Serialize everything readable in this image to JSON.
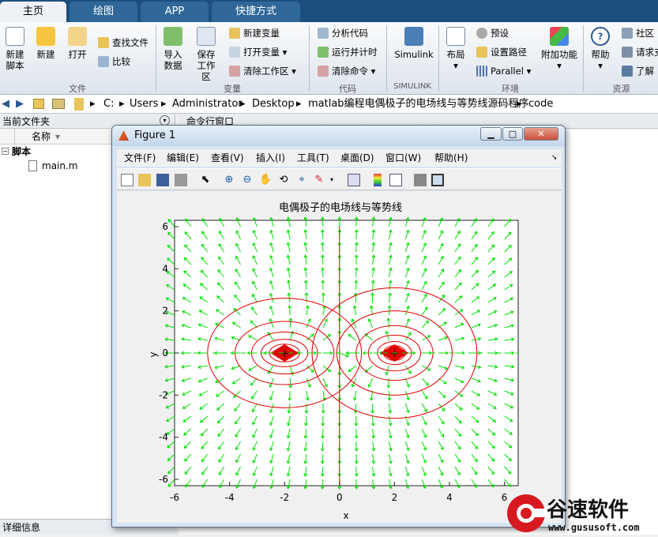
{
  "tabs": [
    {
      "label": "主页",
      "active": true
    },
    {
      "label": "绘图",
      "active": false
    },
    {
      "label": "APP",
      "active": false
    },
    {
      "label": "快捷方式",
      "active": false
    }
  ],
  "ribbon": {
    "file": {
      "new_script": "新建\n脚本",
      "new": "新建",
      "open": "打开",
      "find_files": "查找文件",
      "compare": "比较",
      "group": "文件"
    },
    "variable": {
      "import_data": "导入\n数据",
      "save_workspace": "保存\n工作区",
      "new_variable": "新建变量",
      "open_variable": "打开变量",
      "clear_workspace": "清除工作区",
      "group": "变量"
    },
    "code": {
      "analyze": "分析代码",
      "run_time": "运行并计时",
      "clear_commands": "清除命令",
      "group": "代码"
    },
    "simulink": {
      "label": "Simulink",
      "group": "SIMULINK"
    },
    "env": {
      "layout": "布局",
      "preferences": "预设",
      "set_path": "设置路径",
      "parallel": "Parallel",
      "addons": "附加功能",
      "group": "环境"
    },
    "resources": {
      "help": "帮助",
      "community": "社区",
      "request_support": "请求支",
      "learn": "了解",
      "group": "资源"
    }
  },
  "address": {
    "parts": [
      "C:",
      "Users",
      "Administrator",
      "Desktop",
      "matlab编程电偶极子的电场线与等势线源码程序",
      "code"
    ]
  },
  "file_panel": {
    "title": "当前文件夹",
    "column_name": "名称",
    "folder": "脚本",
    "file": "main.m",
    "details": "详细信息"
  },
  "command_window": {
    "title": "命令行窗口"
  },
  "figure": {
    "title": "Figure 1",
    "menu": [
      "文件(F)",
      "编辑(E)",
      "查看(V)",
      "插入(I)",
      "工具(T)",
      "桌面(D)",
      "窗口(W)",
      "帮助(H)"
    ]
  },
  "chart_data": {
    "type": "contour+quiver",
    "title": "电偶极子的电场线与等势线",
    "xlabel": "x",
    "ylabel": "y",
    "xlim": [
      -6,
      6.5
    ],
    "ylim": [
      -6.3,
      6.3
    ],
    "xticks": [
      -6,
      -4,
      -2,
      0,
      2,
      4,
      6
    ],
    "yticks": [
      6,
      4,
      2,
      0,
      -2,
      -4,
      -6
    ],
    "charges": [
      {
        "x": -2,
        "y": 0
      },
      {
        "x": 2,
        "y": 0
      }
    ],
    "vector_color": "#00e000",
    "contour_color": "#e00000",
    "contour_levels_left": [
      [
        2.8,
        2.6
      ],
      [
        1.8,
        1.5
      ],
      [
        1.2,
        1.0
      ],
      [
        0.85,
        0.65
      ],
      [
        0.55,
        0.42
      ],
      [
        0.35,
        0.28
      ]
    ],
    "contour_levels_right": [
      [
        3.0,
        3.1
      ],
      [
        2.1,
        2.0
      ],
      [
        1.4,
        1.3
      ],
      [
        0.95,
        0.85
      ],
      [
        0.62,
        0.55
      ],
      [
        0.4,
        0.35
      ]
    ]
  },
  "watermark": {
    "text": "谷速软件",
    "url": "www.gususoft.com"
  }
}
